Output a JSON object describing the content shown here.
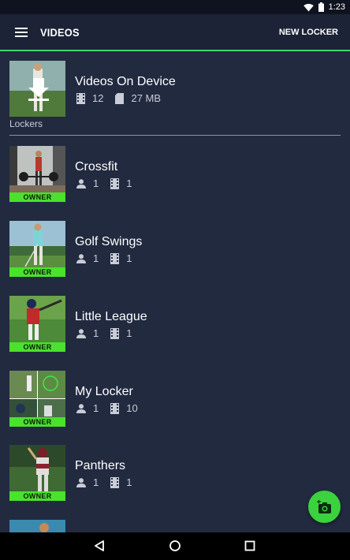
{
  "status_bar": {
    "time": "1:23"
  },
  "app_bar": {
    "title": "VIDEOS",
    "action": "NEW LOCKER"
  },
  "device": {
    "title": "Videos On Device",
    "video_count": "12",
    "storage": "27 MB"
  },
  "section_label": "Lockers",
  "lockers": [
    {
      "name": "Crossfit",
      "members": "1",
      "videos": "1",
      "badge": "OWNER"
    },
    {
      "name": "Golf Swings",
      "members": "1",
      "videos": "1",
      "badge": "OWNER"
    },
    {
      "name": "Little League",
      "members": "1",
      "videos": "1",
      "badge": "OWNER"
    },
    {
      "name": "My Locker",
      "members": "1",
      "videos": "10",
      "badge": "OWNER"
    },
    {
      "name": "Panthers",
      "members": "1",
      "videos": "1",
      "badge": "OWNER"
    }
  ],
  "icons": {
    "menu": "menu-icon",
    "wifi": "wifi-icon",
    "battery": "battery-icon",
    "video": "film-icon",
    "storage": "sd-card-icon",
    "person": "person-icon",
    "fab": "add-video-camera-icon",
    "back": "back-icon",
    "home": "home-icon",
    "recents": "recents-icon"
  },
  "colors": {
    "background": "#222a40",
    "app_bar": "#1c2336",
    "accent": "#3fd46a",
    "badge": "#49e22c"
  }
}
